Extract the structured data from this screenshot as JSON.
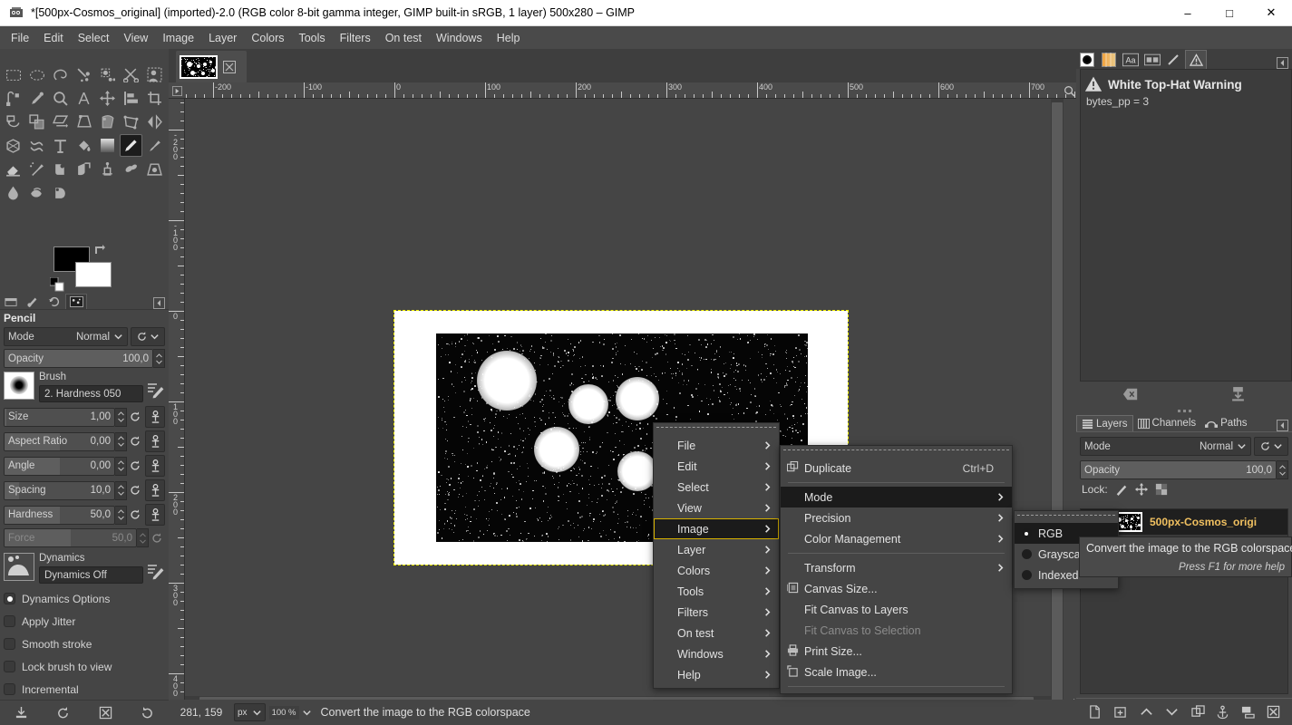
{
  "window": {
    "title": "*[500px-Cosmos_original] (imported)-2.0 (RGB color 8-bit gamma integer, GIMP built-in sRGB, 1 layer) 500x280 – GIMP",
    "app_icon": "gimp-icon",
    "minimize": "–",
    "maximize": "□",
    "close": "✕"
  },
  "menubar": {
    "items": [
      {
        "label": "File"
      },
      {
        "label": "Edit"
      },
      {
        "label": "Select"
      },
      {
        "label": "View"
      },
      {
        "label": "Image"
      },
      {
        "label": "Layer"
      },
      {
        "label": "Colors"
      },
      {
        "label": "Tools"
      },
      {
        "label": "Filters"
      },
      {
        "label": "On test"
      },
      {
        "label": "Windows"
      },
      {
        "label": "Help"
      }
    ]
  },
  "toolbox": {
    "tools": [
      {
        "name": "rect-select-icon"
      },
      {
        "name": "ellipse-select-icon"
      },
      {
        "name": "free-select-icon"
      },
      {
        "name": "fuzzy-select-icon"
      },
      {
        "name": "select-by-color-icon"
      },
      {
        "name": "scissors-select-icon"
      },
      {
        "name": "foreground-select-icon"
      },
      {
        "name": "paths-icon"
      },
      {
        "name": "color-picker-icon"
      },
      {
        "name": "zoom-icon"
      },
      {
        "name": "measure-icon"
      },
      {
        "name": "move-icon"
      },
      {
        "name": "alignment-icon"
      },
      {
        "name": "crop-icon"
      },
      {
        "name": "rotate-icon"
      },
      {
        "name": "scale-icon"
      },
      {
        "name": "shear-icon"
      },
      {
        "name": "perspective-icon"
      },
      {
        "name": "unified-transform-icon"
      },
      {
        "name": "handle-transform-icon"
      },
      {
        "name": "flip-icon"
      },
      {
        "name": "cage-transform-icon"
      },
      {
        "name": "warp-transform-icon"
      },
      {
        "name": "text-icon"
      },
      {
        "name": "bucket-fill-icon"
      },
      {
        "name": "gradient-icon"
      },
      {
        "name": "pencil-icon"
      },
      {
        "name": "paintbrush-icon"
      },
      {
        "name": "eraser-icon"
      },
      {
        "name": "airbrush-icon"
      },
      {
        "name": "ink-icon"
      },
      {
        "name": "mypaint-brush-icon"
      },
      {
        "name": "clone-icon"
      },
      {
        "name": "heal-icon"
      },
      {
        "name": "perspective-clone-icon"
      },
      {
        "name": "blur-sharpen-icon"
      },
      {
        "name": "smudge-icon"
      },
      {
        "name": "dodge-burn-icon"
      }
    ],
    "active_tool": "pencil-icon",
    "foreground_color": "#000000",
    "background_color": "#ffffff",
    "option_tabs": [
      {
        "name": "tool-options-tab"
      },
      {
        "name": "device-status-tab"
      },
      {
        "name": "undo-history-tab"
      },
      {
        "name": "images-tab"
      }
    ],
    "selected_option_tab": 3
  },
  "tool_options": {
    "title": "Pencil",
    "mode": {
      "label": "Mode",
      "value": "Normal"
    },
    "opacity": {
      "label": "Opacity",
      "value": "100,0",
      "fill_pct": 100
    },
    "brush": {
      "caption": "Brush",
      "name": "2. Hardness 050"
    },
    "sliders": [
      {
        "label": "Size",
        "value": "1,00",
        "fill_pct": 2,
        "disabled": false
      },
      {
        "label": "Aspect Ratio",
        "value": "0,00",
        "fill_pct": 50,
        "disabled": false
      },
      {
        "label": "Angle",
        "value": "0,00",
        "fill_pct": 50,
        "disabled": false
      },
      {
        "label": "Spacing",
        "value": "10,0",
        "fill_pct": 13,
        "disabled": false
      },
      {
        "label": "Hardness",
        "value": "50,0",
        "fill_pct": 50,
        "disabled": false
      },
      {
        "label": "Force",
        "value": "50,0",
        "fill_pct": 50,
        "disabled": true
      }
    ],
    "dynamics": {
      "caption": "Dynamics",
      "name": "Dynamics Off"
    },
    "checks": [
      {
        "label": "Dynamics Options",
        "checked": true
      },
      {
        "label": "Apply Jitter",
        "checked": false
      },
      {
        "label": "Smooth stroke",
        "checked": false
      },
      {
        "label": "Lock brush to view",
        "checked": false
      },
      {
        "label": "Incremental",
        "checked": false
      }
    ],
    "footer_buttons": [
      {
        "name": "save-tool-preset-icon"
      },
      {
        "name": "restore-tool-preset-icon"
      },
      {
        "name": "delete-tool-preset-icon"
      },
      {
        "name": "reset-tool-options-icon"
      }
    ]
  },
  "canvas": {
    "tab_name": "image-tab",
    "tab_close": "close-icon",
    "ruler_h_labels": [
      "-200",
      "-100",
      "0",
      "100",
      "200",
      "300",
      "400",
      "500",
      "600",
      "700"
    ],
    "ruler_v_labels": [
      "-200",
      "-100",
      "0",
      "100",
      "200",
      "300",
      "400"
    ]
  },
  "statusbar": {
    "pointer_position": "281, 159",
    "unit": "px",
    "zoom": "100 %",
    "message": "Convert the image to the RGB colorspace"
  },
  "right_dock": {
    "top_tabs": [
      {
        "name": "brushes-tab"
      },
      {
        "name": "gradients-tab"
      },
      {
        "name": "fonts-tab"
      },
      {
        "name": "document-history-tab"
      },
      {
        "name": "pointer-tab"
      },
      {
        "name": "error-console-tab"
      }
    ],
    "selected_top_tab": 5,
    "error_console": {
      "icon": "warning-icon",
      "title": "White Top-Hat Warning",
      "message": "bytes_pp = 3"
    },
    "dock_buttons": [
      {
        "name": "clear-error-console-icon"
      },
      {
        "name": "save-error-log-icon"
      }
    ],
    "layer_tabs": [
      {
        "name": "layers-tab",
        "label": "Layers"
      },
      {
        "name": "channels-tab",
        "label": "Channels"
      },
      {
        "name": "paths-tab",
        "label": "Paths"
      }
    ],
    "selected_layer_tab": 0,
    "layers": {
      "mode": {
        "label": "Mode",
        "value": "Normal"
      },
      "opacity": {
        "label": "Opacity",
        "value": "100,0"
      },
      "lock_label": "Lock:",
      "lock_buttons": [
        {
          "name": "lock-pixels-icon"
        },
        {
          "name": "lock-position-icon"
        },
        {
          "name": "lock-alpha-icon"
        }
      ],
      "items": [
        {
          "name": "500px-Cosmos_origi",
          "visible": true
        }
      ],
      "footer_buttons": [
        {
          "name": "new-layer-icon"
        },
        {
          "name": "new-layer-group-icon"
        },
        {
          "name": "raise-layer-icon"
        },
        {
          "name": "lower-layer-icon"
        },
        {
          "name": "duplicate-layer-icon"
        },
        {
          "name": "anchor-layer-icon"
        },
        {
          "name": "merge-down-icon"
        },
        {
          "name": "delete-layer-icon"
        }
      ]
    }
  },
  "context_menu": {
    "items": [
      {
        "label": "File",
        "submenu": true
      },
      {
        "label": "Edit",
        "submenu": true
      },
      {
        "label": "Select",
        "submenu": true
      },
      {
        "label": "View",
        "submenu": true
      },
      {
        "label": "Image",
        "submenu": true,
        "selected": true
      },
      {
        "label": "Layer",
        "submenu": true
      },
      {
        "label": "Colors",
        "submenu": true
      },
      {
        "label": "Tools",
        "submenu": true
      },
      {
        "label": "Filters",
        "submenu": true
      },
      {
        "label": "On test",
        "submenu": true
      },
      {
        "label": "Windows",
        "submenu": true
      },
      {
        "label": "Help",
        "submenu": true
      }
    ]
  },
  "image_menu": {
    "items": [
      {
        "label": "Duplicate",
        "accel": "Ctrl+D",
        "icon": "duplicate-icon"
      },
      {
        "separator": true
      },
      {
        "label": "Mode",
        "submenu": true,
        "selected": true
      },
      {
        "label": "Precision",
        "submenu": true
      },
      {
        "label": "Color Management",
        "submenu": true
      },
      {
        "separator": true
      },
      {
        "label": "Transform",
        "submenu": true
      },
      {
        "label": "Canvas Size...",
        "icon": "canvas-size-icon"
      },
      {
        "label": "Fit Canvas to Layers"
      },
      {
        "label": "Fit Canvas to Selection",
        "disabled": true
      },
      {
        "label": "Print Size...",
        "icon": "print-size-icon"
      },
      {
        "label": "Scale Image...",
        "icon": "scale-image-icon"
      },
      {
        "separator": true
      }
    ]
  },
  "mode_menu": {
    "items": [
      {
        "label": "RGB",
        "radio": true,
        "checked": true,
        "selected": true
      },
      {
        "label": "Grayscale",
        "radio": true,
        "checked": false
      },
      {
        "label": "Indexed",
        "radio": true,
        "checked": false
      }
    ]
  },
  "tooltip": {
    "text": "Convert the image to the RGB colorspace",
    "hint": "Press F1 for more help"
  },
  "colors": {
    "panel_bg": "#454545",
    "panel_dark": "#3a3a3a",
    "menu_selected": "#1b1b1b",
    "highlight_outline": "#d6b100",
    "layer_name": "#f0c060",
    "selection_dash": "#f5f500"
  }
}
